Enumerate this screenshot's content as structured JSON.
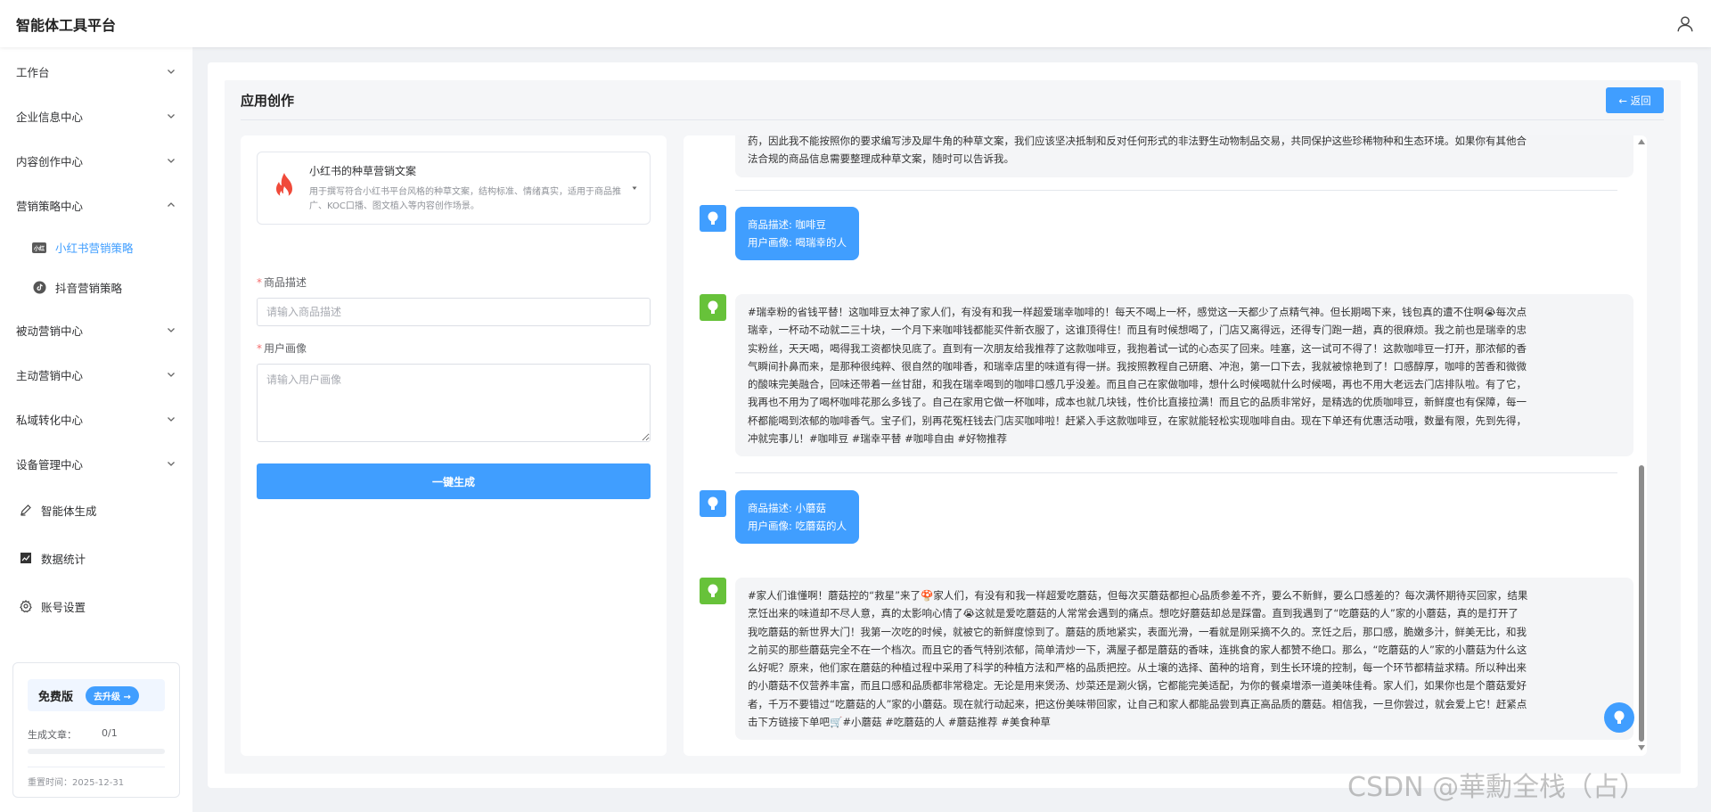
{
  "header": {
    "brand": "智能体工具平台",
    "user_icon": "user-icon"
  },
  "sidebar": {
    "menu": [
      {
        "label": "工作台",
        "expanded": false
      },
      {
        "label": "企业信息中心",
        "expanded": false
      },
      {
        "label": "内容创作中心",
        "expanded": false
      },
      {
        "label": "营销策略中心",
        "expanded": true
      }
    ],
    "submenu": [
      {
        "label": "小红书营销策略",
        "active": true,
        "icon": "xiaohongshu-icon"
      },
      {
        "label": "抖音营销策略",
        "active": false,
        "icon": "douyin-icon"
      }
    ],
    "menu2": [
      {
        "label": "被动营销中心"
      },
      {
        "label": "主动营销中心"
      },
      {
        "label": "私域转化中心"
      },
      {
        "label": "设备管理中心"
      }
    ],
    "plain": [
      {
        "label": "智能体生成",
        "icon": "pen-icon"
      },
      {
        "label": "数据统计",
        "icon": "chart-icon"
      },
      {
        "label": "账号设置",
        "icon": "gear-icon"
      }
    ],
    "plan": {
      "name": "免费版",
      "upgrade": "去升级 →",
      "articles_label": "生成文章：",
      "articles_value": "0/1",
      "progress": 0,
      "reset": "重置时间：2025-12-31"
    }
  },
  "main": {
    "title": "应用创作",
    "back": "← 返回",
    "app": {
      "name": "小红书的种草营销文案",
      "desc": "用于撰写符合小红书平台风格的种草文案，结构标准、情绪真实，适用于商品推广、KOC口播、图文植入等内容创作场景。"
    },
    "fields": {
      "product_label": "商品描述",
      "product_placeholder": "请输入商品描述",
      "persona_label": "用户画像",
      "persona_placeholder": "请输入用户画像"
    },
    "generate": "一键生成"
  },
  "chat": {
    "top_partial": {
      "line1": "药，因此我不能按照你的要求编写涉及犀牛角的种草文案，我们应该坚决抵制和反对任何形式的非法野生动物制品交易，共同保护这些珍稀物种和生态环境。如果你有其他合",
      "line2": "法合规的商品信息需要整理成种草文案，随时可以告诉我。"
    },
    "q1": {
      "line1": "商品描述: 咖啡豆",
      "line2": "用户画像: 喝瑞幸的人"
    },
    "a1": [
      "#瑞幸粉的省钱平替！这咖啡豆太神了家人们，有没有和我一样超爱瑞幸咖啡的！每天不喝上一杯，感觉这一天都少了点精气神。但长期喝下来，钱包真的遭不住啊😭每次点",
      "瑞幸，一杯动不动就二三十块，一个月下来咖啡钱都能买件新衣服了，这谁顶得住！而且有时候想喝了，门店又离得远，还得专门跑一趟，真的很麻烦。我之前也是瑞幸的忠",
      "实粉丝，天天喝，喝得我工资都快见底了。直到有一次朋友给我推荐了这款咖啡豆，我抱着试一试的心态买了回来。哇塞，这一试可不得了！这款咖啡豆一打开，那浓郁的香",
      "气瞬间扑鼻而来，是那种很纯粹、很自然的咖啡香，和瑞幸店里的味道有得一拼。我按照教程自己研磨、冲泡，第一口下去，我就被惊艳到了！口感醇厚，咖啡的苦香和微微",
      "的酸味完美融合，回味还带着一丝甘甜，和我在瑞幸喝到的咖啡口感几乎没差。而且自己在家做咖啡，想什么时候喝就什么时候喝，再也不用大老远去门店排队啦。有了它，",
      "我再也不用为了喝杯咖啡花那么多钱了。自己在家用它做一杯咖啡，成本也就几块钱，性价比直接拉满！而且它的品质非常好，是精选的优质咖啡豆，新鲜度也有保障，每一",
      "杯都能喝到浓郁的咖啡香气。宝子们，别再花冤枉钱去门店买咖啡啦！赶紧入手这款咖啡豆，在家就能轻松实现咖啡自由。现在下单还有优惠活动哦，数量有限，先到先得，",
      "冲就完事儿！#咖啡豆 #瑞幸平替 #咖啡自由 #好物推荐"
    ],
    "q2": {
      "line1": "商品描述: 小蘑菇",
      "line2": "用户画像: 吃蘑菇的人"
    },
    "a2": [
      "#家人们谁懂啊！蘑菇控的“救星”来了🍄家人们，有没有和我一样超爱吃蘑菇，但每次买蘑菇都担心品质参差不齐，要么不新鲜，要么口感差的？每次满怀期待买回家，结果",
      "烹饪出来的味道却不尽人意，真的太影响心情了😭这就是爱吃蘑菇的人常常会遇到的痛点。想吃好蘑菇却总是踩雷。直到我遇到了“吃蘑菇的人”家的小蘑菇，真的是打开了",
      "我吃蘑菇的新世界大门！我第一次吃的时候，就被它的新鲜度惊到了。蘑菇的质地紧实，表面光滑，一看就是刚采摘不久的。烹饪之后，那口感，脆嫩多汁，鲜美无比，和我",
      "之前买的那些蘑菇完全不在一个档次。而且它的香气特别浓郁，简单清炒一下，满屋子都是蘑菇的香味，连挑食的家人都赞不绝口。那么，“吃蘑菇的人”家的小蘑菇为什么这",
      "么好呢？原来，他们家在蘑菇的种植过程中采用了科学的种植方法和严格的品质把控。从土壤的选择、菌种的培育，到生长环境的控制，每一个环节都精益求精。所以种出来",
      "的小蘑菇不仅营养丰富，而且口感和品质都非常稳定。无论是用来煲汤、炒菜还是涮火锅，它都能完美适配，为你的餐桌增添一道美味佳肴。家人们，如果你也是个蘑菇爱好",
      "者，千万不要错过“吃蘑菇的人”家的小蘑菇。现在就行动起来，把这份美味带回家，让自己和家人都能品尝到真正高品质的蘑菇。相信我，一旦你尝过，就会爱上它！赶紧点",
      "击下方链接下单吧🛒#小蘑菇 #吃蘑菇的人 #蘑菇推荐 #美食种草"
    ]
  },
  "watermark": "CSDN @華勳全栈（占）"
}
